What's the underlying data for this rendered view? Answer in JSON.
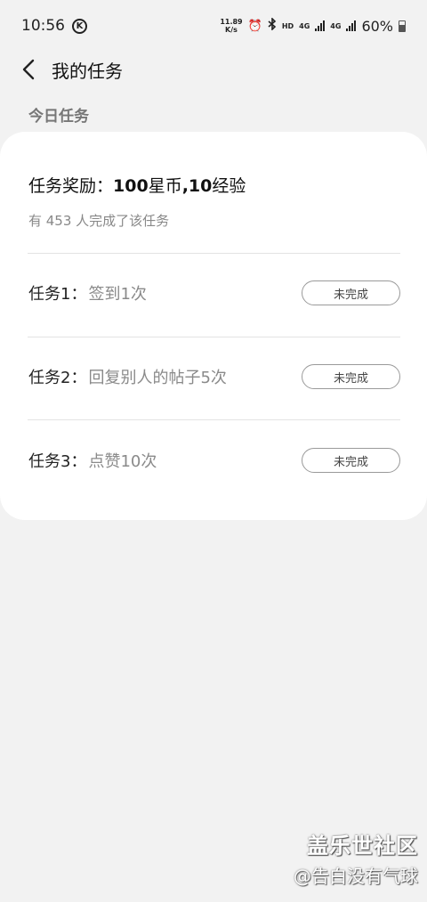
{
  "status_bar": {
    "time": "10:56",
    "k_badge": "K",
    "net_speed_value": "11.89",
    "net_speed_unit": "K/s",
    "hd": "HD",
    "net1": "4G",
    "net2": "4G",
    "battery": "60%"
  },
  "header": {
    "title": "我的任务"
  },
  "section": {
    "title": "今日任务"
  },
  "card": {
    "reward_prefix": "任务奖励：",
    "reward_coins_value": "100",
    "reward_coins_unit": "星币",
    "reward_sep": ",",
    "reward_exp_value": "10",
    "reward_exp_unit": "经验",
    "completed_text": "有 453 人完成了该任务",
    "tasks": [
      {
        "label": "任务1：",
        "desc": "签到1次",
        "status": "未完成"
      },
      {
        "label": "任务2：",
        "desc": "回复别人的帖子5次",
        "status": "未完成"
      },
      {
        "label": "任务3：",
        "desc": "点赞10次",
        "status": "未完成"
      }
    ]
  },
  "watermark": {
    "site": "盖乐世社区",
    "user": "@告白没有气球"
  }
}
